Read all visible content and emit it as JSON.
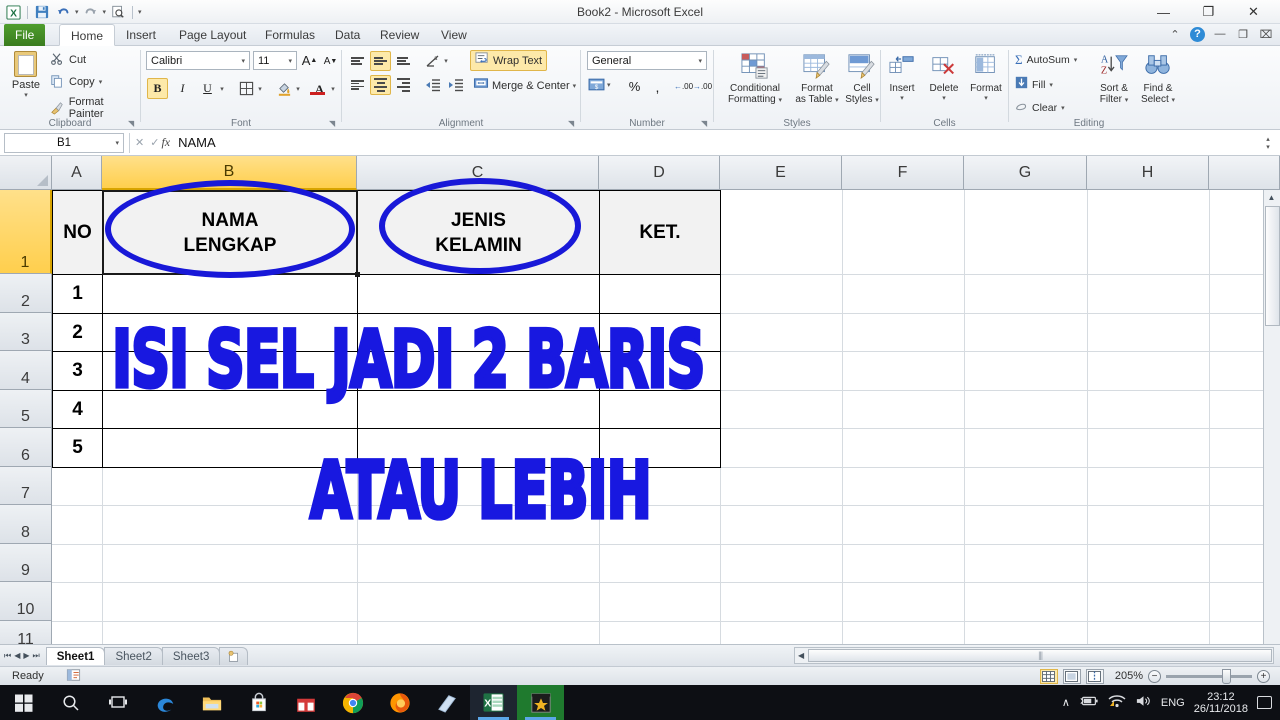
{
  "window": {
    "title": "Book2  -  Microsoft Excel",
    "quick_access": [
      {
        "name": "excel-logo-icon",
        "label": "X"
      },
      {
        "name": "save-icon",
        "label": "Save"
      },
      {
        "name": "undo-icon",
        "label": "Undo"
      },
      {
        "name": "redo-icon",
        "label": "Redo"
      },
      {
        "name": "print-preview-icon",
        "label": "Print Preview"
      },
      {
        "name": "customize-qat-icon",
        "label": "Customize Quick Access Toolbar"
      }
    ],
    "controls": {
      "minimize": "—",
      "maximize": "❐",
      "close": "✕"
    },
    "ribbon_controls": {
      "minimize_ribbon": "⌃",
      "help": "?",
      "restore_down": "❐",
      "close_window": "⌧",
      "min_window": "—"
    }
  },
  "ribbon": {
    "tabs": [
      {
        "label": "File",
        "active": false,
        "file": true
      },
      {
        "label": "Home",
        "active": true
      },
      {
        "label": "Insert",
        "active": false
      },
      {
        "label": "Page Layout",
        "active": false
      },
      {
        "label": "Formulas",
        "active": false
      },
      {
        "label": "Data",
        "active": false
      },
      {
        "label": "Review",
        "active": false
      },
      {
        "label": "View",
        "active": false
      }
    ],
    "groups": {
      "clipboard": {
        "label": "Clipboard",
        "paste": "Paste",
        "cut": "Cut",
        "copy": "Copy",
        "format_painter": "Format Painter"
      },
      "font": {
        "label": "Font",
        "font_name": "Calibri",
        "font_size": "11",
        "grow": "A",
        "shrink": "A",
        "bold": "B",
        "italic": "I",
        "underline": "U",
        "borders": "Borders",
        "fill_color": "Fill Color",
        "font_color": "A"
      },
      "alignment": {
        "label": "Alignment",
        "wrap_text": "Wrap Text",
        "merge_center": "Merge & Center",
        "orientation": "Orientation",
        "indent_decrease": "Decrease Indent",
        "indent_increase": "Increase Indent"
      },
      "number": {
        "label": "Number",
        "format": "General",
        "accounting": "Accounting Number Format",
        "percent": "%",
        "comma": ",",
        "increase_decimal": ".00",
        "decrease_decimal": ".00"
      },
      "styles": {
        "label": "Styles",
        "conditional_formatting": "Conditional\nFormatting",
        "conditional_formatting_l1": "Conditional",
        "conditional_formatting_l2": "Formatting",
        "format_as_table_l1": "Format",
        "format_as_table_l2": "as Table",
        "cell_styles_l1": "Cell",
        "cell_styles_l2": "Styles"
      },
      "cells": {
        "label": "Cells",
        "insert": "Insert",
        "delete": "Delete",
        "format": "Format"
      },
      "editing": {
        "label": "Editing",
        "autosum": "AutoSum",
        "fill": "Fill",
        "clear": "Clear",
        "sort_filter_l1": "Sort &",
        "sort_filter_l2": "Filter",
        "find_select_l1": "Find &",
        "find_select_l2": "Select"
      }
    }
  },
  "formula_bar": {
    "name_box": "B1",
    "fx_label": "fx",
    "value": "NAMA"
  },
  "grid": {
    "columns": [
      "A",
      "B",
      "C",
      "D",
      "E",
      "F",
      "G",
      "H"
    ],
    "selected_column": "B",
    "rows": [
      "1",
      "2",
      "3",
      "4",
      "5",
      "6",
      "7",
      "8",
      "9",
      "10",
      "11"
    ],
    "selected_row": "1",
    "header_row": {
      "A": "NO",
      "B_line1": "NAMA",
      "B_line2": "LENGKAP",
      "C_line1": "JENIS",
      "C_line2": "KELAMIN",
      "D": "KET."
    },
    "data_rows": [
      {
        "row": "2",
        "A": "1",
        "B": "",
        "C": "",
        "D": ""
      },
      {
        "row": "3",
        "A": "2",
        "B": "",
        "C": "",
        "D": ""
      },
      {
        "row": "4",
        "A": "3",
        "B": "",
        "C": "",
        "D": ""
      },
      {
        "row": "5",
        "A": "4",
        "B": "",
        "C": "",
        "D": ""
      },
      {
        "row": "6",
        "A": "5",
        "B": "",
        "C": "",
        "D": ""
      }
    ]
  },
  "annotations": {
    "accent_color": "#1818e0",
    "line1": "ISI SEL JADI 2 BARIS",
    "line2": "ATAU LEBIH",
    "ellipse_b1": "highlight-nama-lengkap",
    "ellipse_c1": "highlight-jenis-kelamin"
  },
  "sheet_tabs": {
    "nav": {
      "first": "⏮",
      "prev": "◀",
      "next": "▶",
      "last": "⏭"
    },
    "tabs": [
      {
        "label": "Sheet1",
        "active": true
      },
      {
        "label": "Sheet2",
        "active": false
      },
      {
        "label": "Sheet3",
        "active": false
      }
    ],
    "insert_sheet": "Insert Worksheet"
  },
  "status_bar": {
    "status": "Ready",
    "views": [
      {
        "name": "normal-view",
        "active": true
      },
      {
        "name": "page-layout-view",
        "active": false
      },
      {
        "name": "page-break-view",
        "active": false
      }
    ],
    "zoom": "205%",
    "zoom_out": "−",
    "zoom_in": "+"
  },
  "taskbar": {
    "items": [
      {
        "name": "start-button",
        "label": "Start"
      },
      {
        "name": "search-icon",
        "label": "Search"
      },
      {
        "name": "task-view-icon",
        "label": "Task View"
      },
      {
        "name": "edge-icon",
        "label": "Microsoft Edge"
      },
      {
        "name": "file-explorer-icon",
        "label": "File Explorer"
      },
      {
        "name": "microsoft-store-icon",
        "label": "Microsoft Store"
      },
      {
        "name": "gift-icon",
        "label": "Gift"
      },
      {
        "name": "chrome-icon",
        "label": "Google Chrome"
      },
      {
        "name": "firefox-icon",
        "label": "Mozilla Firefox"
      },
      {
        "name": "sticky-notes-icon",
        "label": "Sticky Notes"
      },
      {
        "name": "excel-taskbar-icon",
        "label": "Microsoft Excel"
      },
      {
        "name": "recorder-icon",
        "label": "Screen Recorder"
      }
    ],
    "tray": {
      "show_hidden": "∧",
      "battery": "Battery",
      "network": "Network",
      "volume": "Volume",
      "language": "ENG",
      "time": "23:12",
      "date": "26/11/2018",
      "action_center": "Notifications"
    }
  }
}
